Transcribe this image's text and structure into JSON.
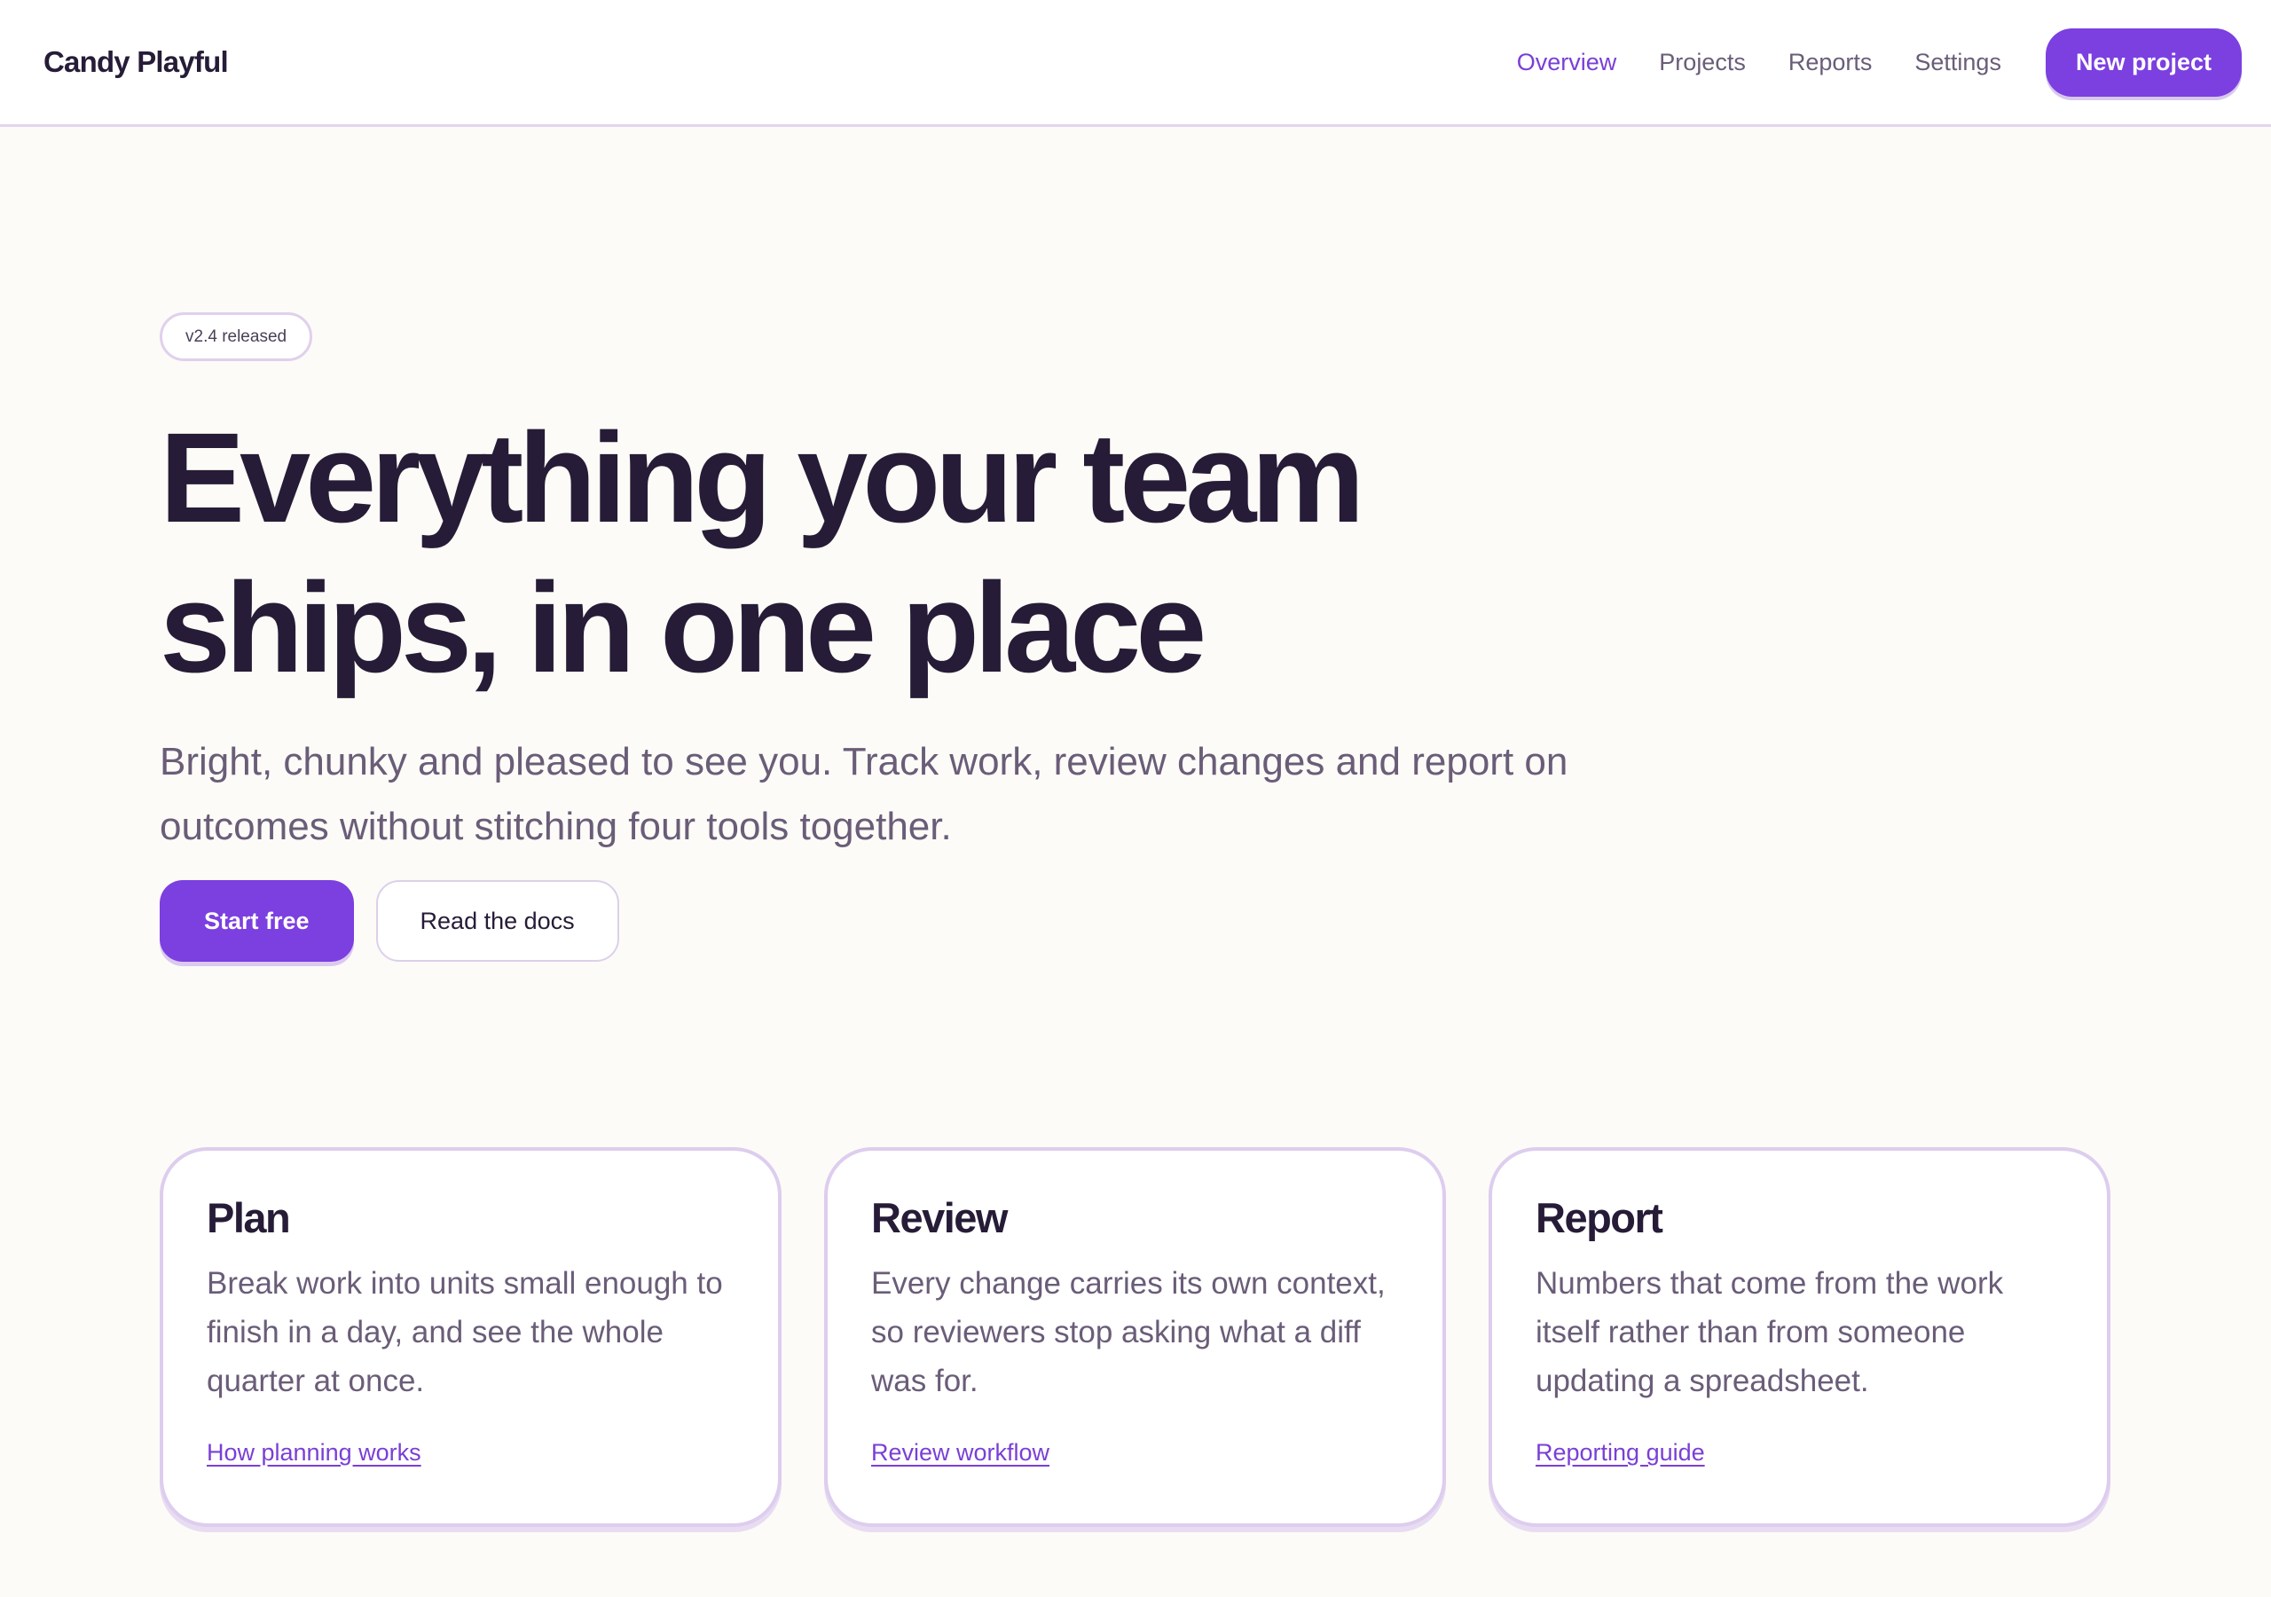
{
  "brand": "Candy Playful",
  "nav": {
    "items": [
      "Overview",
      "Projects",
      "Reports",
      "Settings"
    ],
    "active": "Overview",
    "cta": "New project"
  },
  "hero": {
    "badge": "v2.4 released",
    "headline": "Everything your team ships, in one place",
    "lede": "Bright, chunky and pleased to see you. Track work, review changes and report on outcomes without stitching four tools together.",
    "primary_cta": "Start free",
    "secondary_cta": "Read the docs"
  },
  "cards": [
    {
      "title": "Plan",
      "body": "Break work into units small enough to finish in a day, and see the whole quarter at once.",
      "link": "How planning works"
    },
    {
      "title": "Review",
      "body": "Every change carries its own context, so reviewers stop asking what a diff was for.",
      "link": "Review workflow"
    },
    {
      "title": "Report",
      "body": "Numbers that come from the work itself rather than from someone updating a spreadsheet.",
      "link": "Reporting guide"
    }
  ],
  "colors": {
    "accent": "#7c3fe0",
    "ink": "#261c37",
    "muted": "#6a5d78",
    "background": "#fcfbf7",
    "border": "#ddcdee"
  }
}
